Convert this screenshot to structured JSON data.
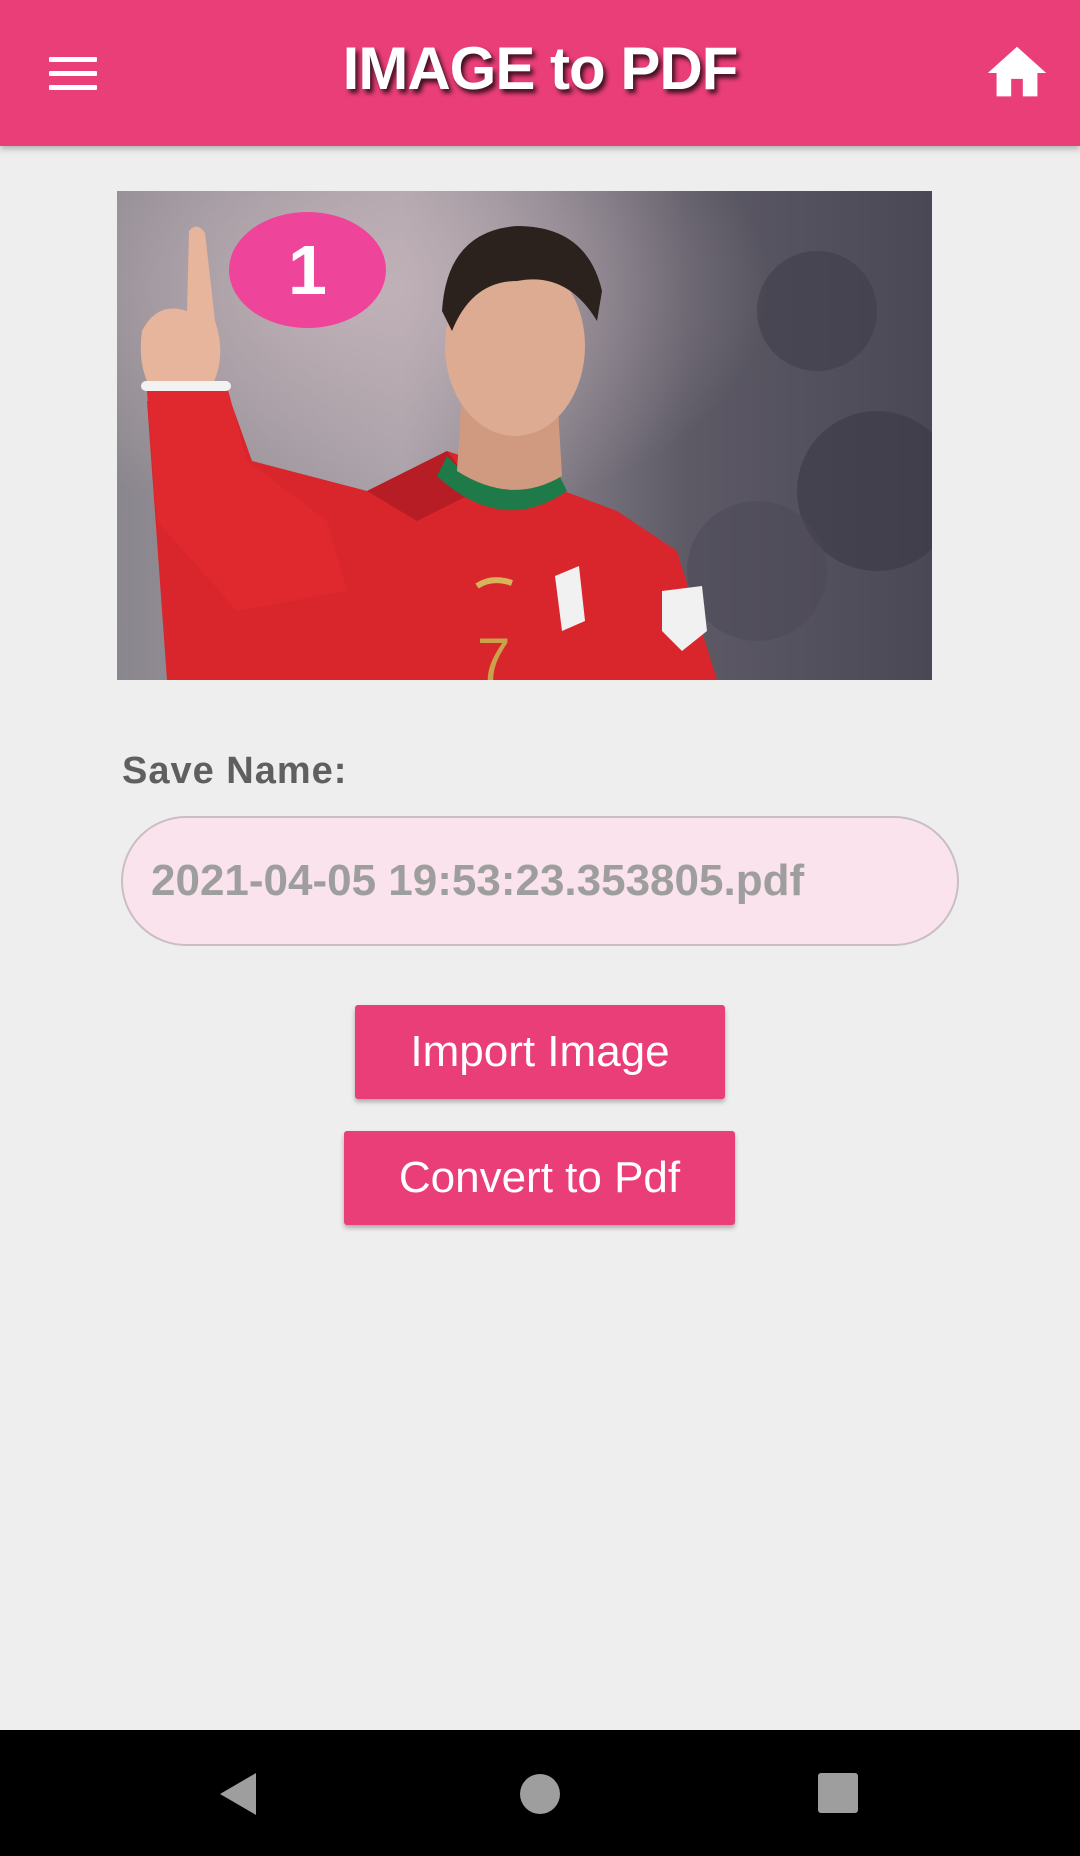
{
  "appbar": {
    "title": "IMAGE to PDF",
    "menu_icon": "hamburger-menu-icon",
    "home_icon": "home-icon",
    "color": "#ea3e79"
  },
  "preview": {
    "badge": "1"
  },
  "form": {
    "save_name_label": "Save Name:",
    "file_name_value": "2021-04-05 19:53:23.353805.pdf"
  },
  "actions": {
    "import_label": "Import Image",
    "convert_label": "Convert to Pdf"
  },
  "system_nav": {
    "back_icon": "back-triangle-icon",
    "home_icon": "home-circle-icon",
    "recents_icon": "recents-square-icon"
  }
}
